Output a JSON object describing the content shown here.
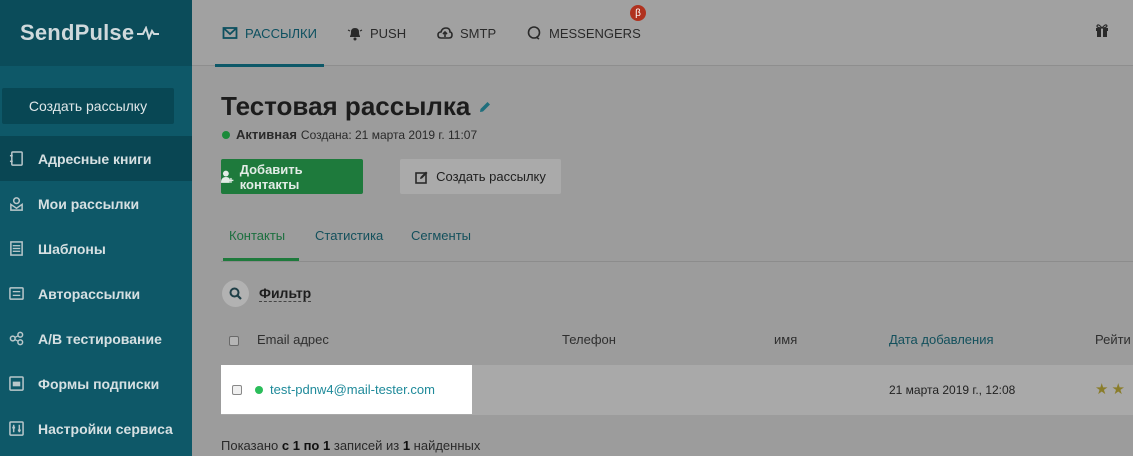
{
  "brand": {
    "logo": "SendPulse"
  },
  "sidebar": {
    "create_button": "Создать рассылку",
    "items": [
      {
        "label": "Адресные книги",
        "icon": "address-book-icon",
        "active": true
      },
      {
        "label": "Мои рассылки",
        "icon": "mailing-icon",
        "active": false
      },
      {
        "label": "Шаблоны",
        "icon": "templates-icon",
        "active": false
      },
      {
        "label": "Авторассылки",
        "icon": "automation-icon",
        "active": false
      },
      {
        "label": "A/B тестирование",
        "icon": "ab-test-icon",
        "active": false
      },
      {
        "label": "Формы подписки",
        "icon": "forms-icon",
        "active": false
      },
      {
        "label": "Настройки сервиса",
        "icon": "settings-icon",
        "active": false
      }
    ]
  },
  "topnav": {
    "tabs": [
      {
        "label": "РАССЫЛКИ",
        "icon": "envelope-icon",
        "active": true
      },
      {
        "label": "PUSH",
        "icon": "bell-icon",
        "active": false
      },
      {
        "label": "SMTP",
        "icon": "cloud-upload-icon",
        "active": false
      },
      {
        "label": "MESSENGERS",
        "icon": "chat-bubble-icon",
        "active": false
      }
    ],
    "beta_badge": "β",
    "gift_icon": "gift-icon"
  },
  "page": {
    "title": "Тестовая рассылка",
    "status": "Активная",
    "created": "Создана: 21 марта 2019 г. 11:07",
    "add_contacts_button": "Добавить контакты",
    "create_mailing_button": "Создать рассылку"
  },
  "subtabs": [
    {
      "label": "Контакты",
      "active": true
    },
    {
      "label": "Статистика",
      "active": false
    },
    {
      "label": "Сегменты",
      "active": false
    }
  ],
  "filter": {
    "label": "Фильтр"
  },
  "table": {
    "columns": [
      "Email адрес",
      "Телефон",
      "имя",
      "Дата добавления",
      "Рейти"
    ],
    "rows": [
      {
        "email": "test-pdnw4@mail-tester.com",
        "phone": "",
        "name": "",
        "date_added": "21 марта 2019 г., 12:08",
        "rating": 2
      }
    ]
  },
  "footer": {
    "prefix": "Показано",
    "from_label": "с",
    "from": "1",
    "to_label": "по",
    "to": "1",
    "records_label": "записей из",
    "total": "1",
    "found_label": "найденных"
  },
  "colors": {
    "sidebar": "#0e5868",
    "accent_green": "#1e7a3c",
    "link": "#1f8a9a",
    "beta": "#b0321f"
  }
}
